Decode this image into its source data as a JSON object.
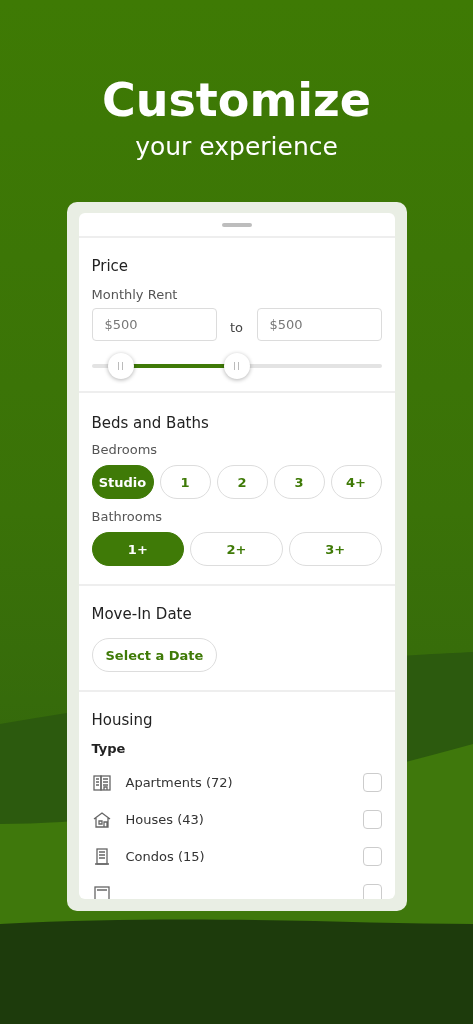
{
  "headline": {
    "title": "Customize",
    "subtitle": "your experience"
  },
  "price": {
    "title": "Price",
    "label": "Monthly Rent",
    "min": {
      "placeholder": "$500"
    },
    "separator": "to",
    "max": {
      "placeholder": "$500"
    },
    "slider": {
      "thumbs": [
        {
          "level": 0.1
        },
        {
          "level": 0.5
        }
      ]
    }
  },
  "beds_baths": {
    "title": "Beds and Baths",
    "bedrooms_label": "Bedrooms",
    "bedrooms": [
      {
        "label": "Studio",
        "selected": true
      },
      {
        "label": "1",
        "selected": false
      },
      {
        "label": "2",
        "selected": false
      },
      {
        "label": "3",
        "selected": false
      },
      {
        "label": "4+",
        "selected": false
      }
    ],
    "bathrooms_label": "Bathrooms",
    "bathrooms": [
      {
        "label": "1+",
        "selected": true
      },
      {
        "label": "2+",
        "selected": false
      },
      {
        "label": "3+",
        "selected": false
      }
    ]
  },
  "move_in": {
    "title": "Move-In Date",
    "button": "Select a Date"
  },
  "housing": {
    "title": "Housing",
    "type_label": "Type",
    "types": [
      {
        "kind": "apartment",
        "label": "Apartments (72)",
        "checked": false
      },
      {
        "kind": "house",
        "label": "Houses (43)",
        "checked": false
      },
      {
        "kind": "condo",
        "label": "Condos (15)",
        "checked": false
      },
      {
        "kind": "townhome",
        "checked": false
      }
    ]
  }
}
